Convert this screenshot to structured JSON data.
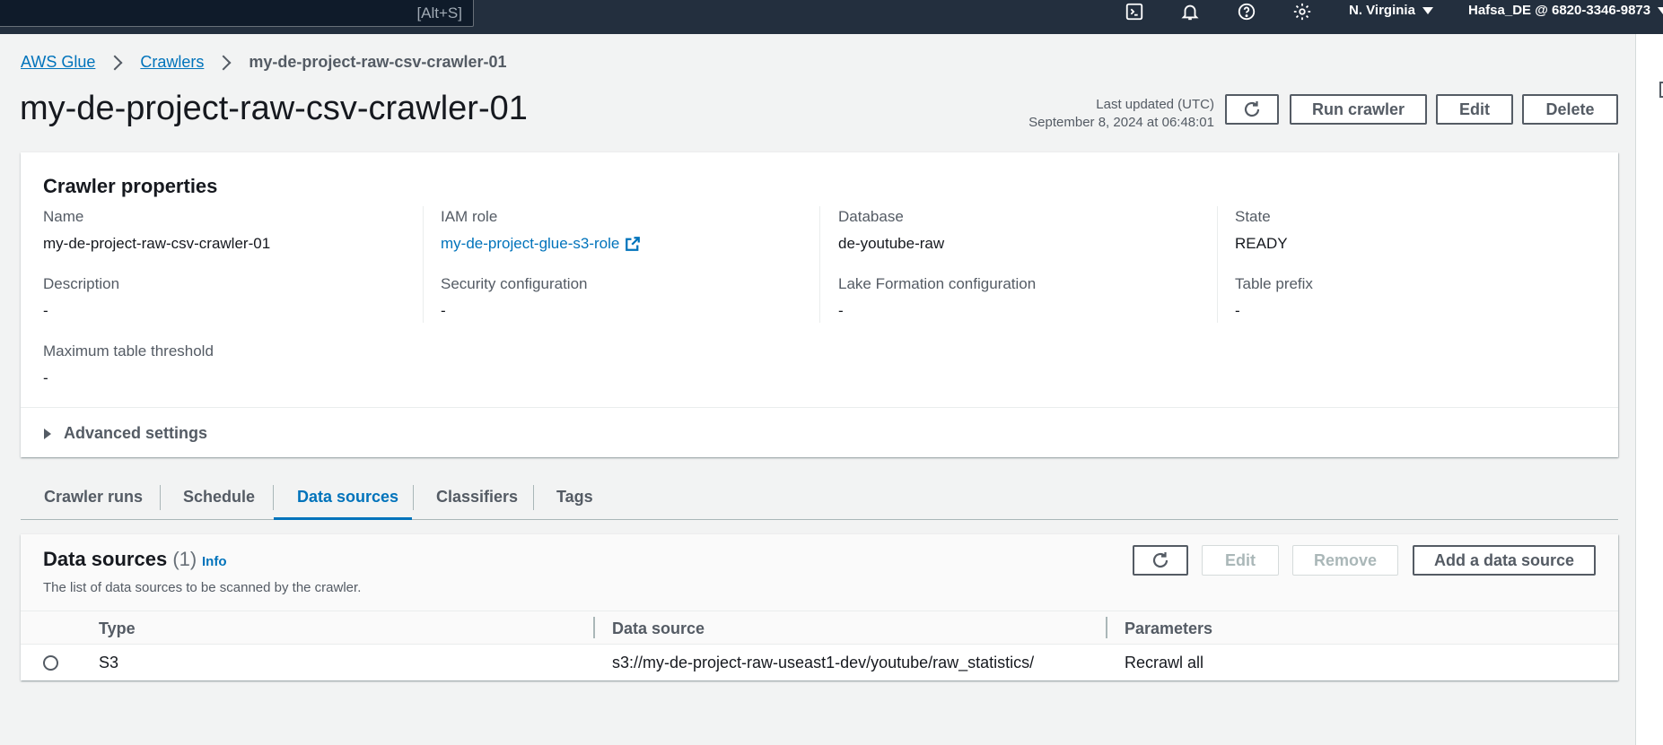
{
  "topnav": {
    "search_shortcut": "[Alt+S]",
    "region": "N. Virginia",
    "account": "Hafsa_DE @ 6820-3346-9873"
  },
  "breadcrumb": {
    "items": [
      "AWS Glue",
      "Crawlers"
    ],
    "current": "my-de-project-raw-csv-crawler-01"
  },
  "header": {
    "title": "my-de-project-raw-csv-crawler-01",
    "last_updated_label": "Last updated (UTC)",
    "last_updated_value": "September 8, 2024 at 06:48:01",
    "run_label": "Run crawler",
    "edit_label": "Edit",
    "delete_label": "Delete"
  },
  "properties": {
    "title": "Crawler properties",
    "name_label": "Name",
    "name_value": "my-de-project-raw-csv-crawler-01",
    "iam_label": "IAM role",
    "iam_value": "my-de-project-glue-s3-role",
    "database_label": "Database",
    "database_value": "de-youtube-raw",
    "state_label": "State",
    "state_value": "READY",
    "description_label": "Description",
    "description_value": "-",
    "security_label": "Security configuration",
    "security_value": "-",
    "lake_label": "Lake Formation configuration",
    "lake_value": "-",
    "prefix_label": "Table prefix",
    "prefix_value": "-",
    "threshold_label": "Maximum table threshold",
    "threshold_value": "-",
    "advanced_label": "Advanced settings"
  },
  "tabs": [
    "Crawler runs",
    "Schedule",
    "Data sources",
    "Classifiers",
    "Tags"
  ],
  "active_tab": "Data sources",
  "data_sources": {
    "title": "Data sources",
    "count": "(1)",
    "info": "Info",
    "description": "The list of data sources to be scanned by the crawler.",
    "edit_label": "Edit",
    "remove_label": "Remove",
    "add_label": "Add a data source",
    "columns": [
      "Type",
      "Data source",
      "Parameters"
    ],
    "rows": [
      {
        "type": "S3",
        "source": "s3://my-de-project-raw-useast1-dev/youtube/raw_statistics/",
        "parameters": "Recrawl all"
      }
    ]
  },
  "colors": {
    "nav_bg": "#232f3e",
    "link": "#0073bb",
    "page_bg": "#f2f3f3"
  }
}
